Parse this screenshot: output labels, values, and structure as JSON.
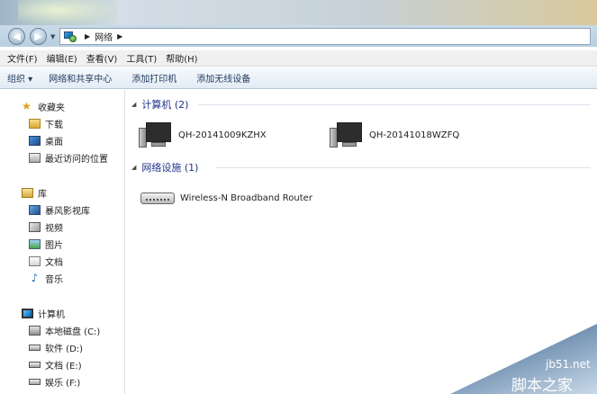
{
  "address": {
    "location": "网络"
  },
  "menu": [
    "文件(F)",
    "编辑(E)",
    "查看(V)",
    "工具(T)",
    "帮助(H)"
  ],
  "toolbar": {
    "organize": "组织 ▾",
    "network_center": "网络和共享中心",
    "add_printer": "添加打印机",
    "add_wireless": "添加无线设备"
  },
  "nav": {
    "favorites": "收藏夹",
    "downloads": "下载",
    "desktop": "桌面",
    "recent": "最近访问的位置",
    "libraries": "库",
    "storm": "暴风影视库",
    "videos": "视频",
    "pictures": "图片",
    "documents": "文档",
    "music": "音乐",
    "computer": "计算机",
    "local_c": "本地磁盘 (C:)",
    "software_d": "软件 (D:)",
    "docs_e": "文档 (E:)",
    "ent_f": "娱乐 (F:)"
  },
  "groups": {
    "computers_header": "计算机 (2)",
    "computer1": "QH-20141009KZHX",
    "computer2": "QH-20141018WZFQ",
    "infra_header": "网络设施 (1)",
    "router": "Wireless-N Broadband Router"
  },
  "watermark": {
    "site": "jb51.net",
    "brand": "脚本之家"
  },
  "colors": {
    "group_header": "#1e3287",
    "toolbar_text": "#1e395b"
  }
}
